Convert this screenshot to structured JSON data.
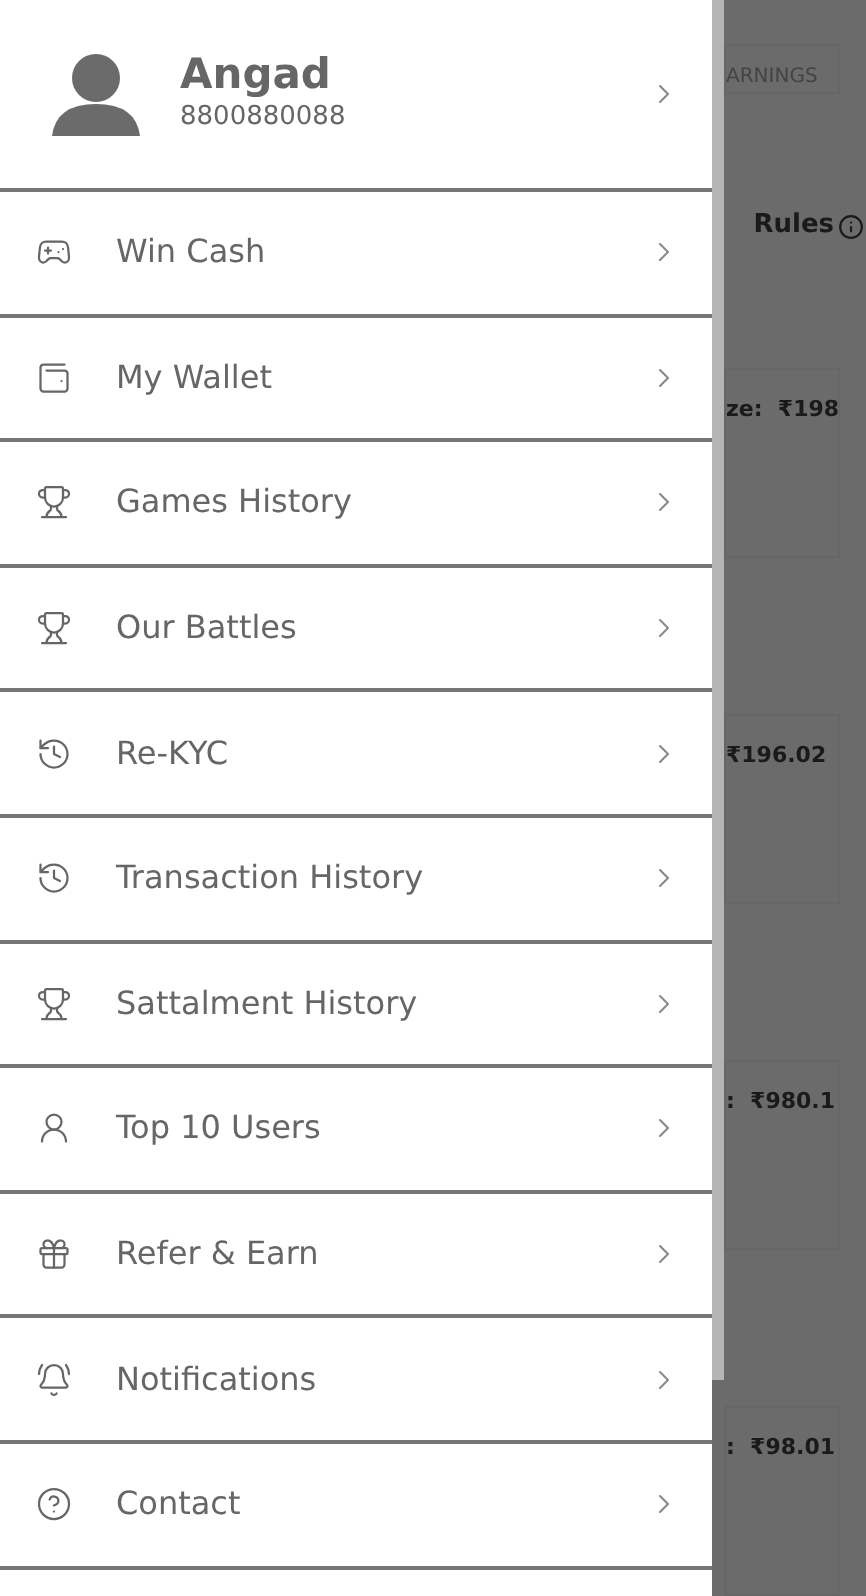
{
  "profile": {
    "name": "Angad",
    "phone": "8800880088"
  },
  "menu": [
    {
      "label": "Win Cash"
    },
    {
      "label": "My Wallet"
    },
    {
      "label": "Games History"
    },
    {
      "label": "Our Battles"
    },
    {
      "label": "Re-KYC"
    },
    {
      "label": "Transaction History"
    },
    {
      "label": "Sattalment History"
    },
    {
      "label": "Top 10 Users"
    },
    {
      "label": "Refer & Earn"
    },
    {
      "label": "Notifications"
    },
    {
      "label": "Contact"
    }
  ],
  "background": {
    "tab": "ARNINGS",
    "rules": "Rules",
    "prizes": [
      "ze:  ₹198",
      "₹196.02",
      ":  ₹980.1",
      ":  ₹98.01"
    ]
  }
}
